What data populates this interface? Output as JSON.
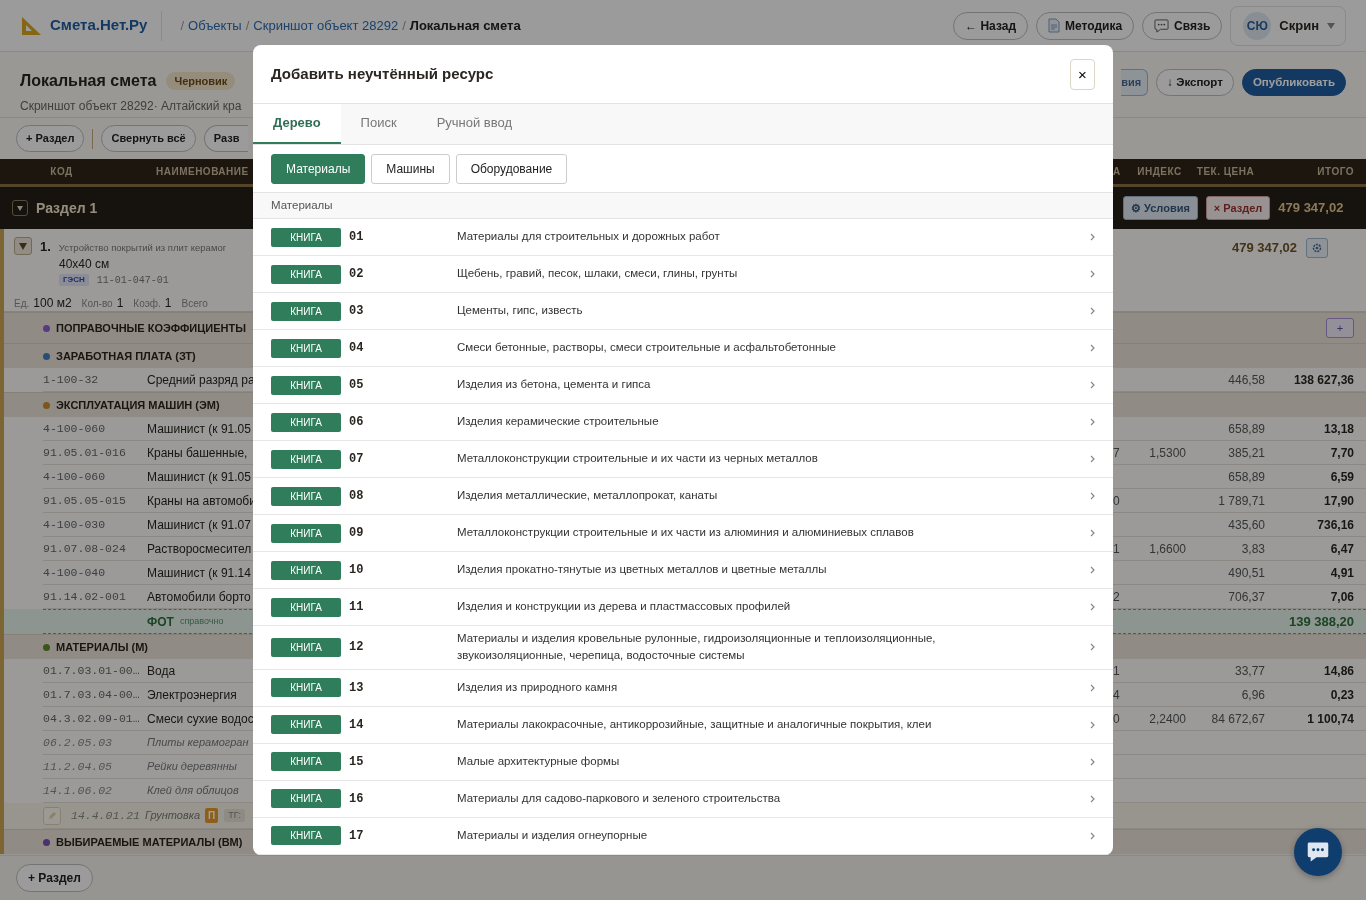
{
  "app": {
    "logo": "Смета.Нет.Ру",
    "breadcrumbs": [
      {
        "sep": "/",
        "label": "Объекты",
        "current": false
      },
      {
        "sep": "/",
        "label": "Скриншот объект 28292",
        "current": false
      },
      {
        "sep": "/",
        "label": "Локальная смета",
        "current": true
      }
    ],
    "header_buttons": [
      {
        "label": "← Назад"
      },
      {
        "label": "Методика"
      },
      {
        "label": "Связь"
      }
    ],
    "user": {
      "initials": "СЮ",
      "name": "Скрин"
    }
  },
  "page": {
    "title": "Локальная смета",
    "status": "Черновик",
    "subtitle": "Скриншот объект 28292· Алтайский кра",
    "actions": [
      {
        "label": "вия",
        "kind": "secondary"
      },
      {
        "label": "↓ Экспорт",
        "kind": "outline"
      },
      {
        "label": "Опубликовать",
        "kind": "primary"
      }
    ]
  },
  "toolbar": [
    "+ Раздел",
    "Свернуть всё",
    "Разв"
  ],
  "table": {
    "columns_left": [
      "КОД",
      "НАИМЕНОВАНИЕ"
    ],
    "columns_right": [
      "А",
      "ИНДЕКС",
      "ТЕК. ЦЕНА",
      "ИТОГО"
    ],
    "section": {
      "title": "Раздел 1",
      "buttons": [
        "⚙ Условия",
        "× Раздел"
      ],
      "total": "479 347,02"
    },
    "item": {
      "number": "1.",
      "title": "Устройство покрытий из плит керамог",
      "size": "40x40 см",
      "tag": "ГЭСН",
      "code": "11-01-047-01",
      "meta": [
        {
          "label": "Ед.",
          "value": "100 м2"
        },
        {
          "label": "Кол-во",
          "value": "1"
        },
        {
          "label": "Коэф.",
          "value": "1"
        },
        {
          "label": "Всего"
        }
      ],
      "total": "479 347,02"
    },
    "rows": [
      {
        "kind": "group",
        "label": "ПОПРАВОЧНЫЕ КОЭФФИЦИЕНТЫ",
        "color": "#563b83",
        "add": "+"
      },
      {
        "kind": "group",
        "label": "ЗАРАБОТНАЯ ПЛАТА (ЗТ)",
        "color": "#274f76"
      },
      {
        "kind": "line",
        "code": "1-100-32",
        "name": "Средний разряд ра",
        "price": "446,58",
        "total": "138 627,36"
      },
      {
        "kind": "group",
        "label": "ЭКСПЛУАТАЦИЯ МАШИН (ЭМ)",
        "color": "#7c561a"
      },
      {
        "kind": "line",
        "code": "4-100-060",
        "name": "Машинист (к 91.05",
        "price": "658,89",
        "total": "13,18"
      },
      {
        "kind": "line",
        "code": "91.05.01-016",
        "name": "Краны башенные,",
        "column_1": "7",
        "index": "1,5300",
        "price": "385,21",
        "total": "7,70"
      },
      {
        "kind": "line",
        "code": "4-100-060",
        "name": "Машинист (к 91.05",
        "price": "658,89",
        "total": "6,59"
      },
      {
        "kind": "line",
        "code": "91.05.05-015",
        "name": "Краны на автомоби",
        "column_1": "0",
        "price": "1 789,71",
        "total": "17,90"
      },
      {
        "kind": "line",
        "code": "4-100-030",
        "name": "Машинист (к 91.07",
        "price": "435,60",
        "total": "736,16"
      },
      {
        "kind": "line",
        "code": "91.07.08-024",
        "name": "Растворосмесител",
        "column_1": "1",
        "index": "1,6600",
        "price": "3,83",
        "total": "6,47"
      },
      {
        "kind": "line",
        "code": "4-100-040",
        "name": "Машинист (к 91.14",
        "price": "490,51",
        "total": "4,91"
      },
      {
        "kind": "line",
        "code": "91.14.02-001",
        "name": "Автомобили борто",
        "column_1": "2",
        "price": "706,37",
        "total": "7,06"
      },
      {
        "kind": "fot",
        "label": "ФОТ",
        "note": "справочно",
        "total": "139 388,20"
      },
      {
        "kind": "group",
        "label": "МАТЕРИАЛЫ (М)",
        "color": "#38561d"
      },
      {
        "kind": "line",
        "code": "01.7.03.01-00…",
        "name": "Вода",
        "column_1": "1",
        "price": "33,77",
        "total": "14,86"
      },
      {
        "kind": "line",
        "code": "01.7.03.04-00…",
        "name": "Электроэнергия",
        "column_1": "4",
        "price": "6,96",
        "total": "0,23"
      },
      {
        "kind": "line",
        "code": "04.3.02.09-01…",
        "name": "Смеси сухие водос",
        "column_1": "0",
        "index": "2,2400",
        "price": "84 672,67",
        "total": "1 100,74"
      },
      {
        "kind": "unaccounted",
        "code": "06.2.05.03",
        "name": "Плиты керамогран"
      },
      {
        "kind": "unaccounted",
        "code": "11.2.04.05",
        "name": "Рейки деревянны"
      },
      {
        "kind": "unaccounted",
        "code": "14.1.06.02",
        "name": "Клей для облицов"
      },
      {
        "kind": "edit",
        "code": "14.4.01.21",
        "name": "Грунтовка",
        "badge": "П",
        "tag": "ТГ:"
      },
      {
        "kind": "group",
        "label": "ВЫБИРАЕМЫЕ МАТЕРИАЛЫ (ВМ)",
        "color": "#4b316d"
      }
    ]
  },
  "footer_button": "+ Раздел",
  "modal": {
    "title": "Добавить неучтённый ресурс",
    "close": "×",
    "tabs": [
      {
        "label": "Дерево",
        "selected": true
      },
      {
        "label": "Поиск",
        "selected": false
      },
      {
        "label": "Ручной ввод",
        "selected": false
      }
    ],
    "filters": [
      {
        "label": "Материалы",
        "selected": true
      },
      {
        "label": "Машины",
        "selected": false
      },
      {
        "label": "Оборудование",
        "selected": false
      }
    ],
    "list_heading": "Материалы",
    "items": [
      {
        "tag": "КНИГА",
        "code": "01",
        "name": "Материалы для строительных и дорожных работ"
      },
      {
        "tag": "КНИГА",
        "code": "02",
        "name": "Щебень, гравий, песок, шлаки, смеси, глины, грунты"
      },
      {
        "tag": "КНИГА",
        "code": "03",
        "name": "Цементы, гипс, известь"
      },
      {
        "tag": "КНИГА",
        "code": "04",
        "name": "Смеси бетонные, растворы, смеси строительные и асфальтобетонные"
      },
      {
        "tag": "КНИГА",
        "code": "05",
        "name": "Изделия из бетона, цемента и гипса"
      },
      {
        "tag": "КНИГА",
        "code": "06",
        "name": "Изделия керамические строительные"
      },
      {
        "tag": "КНИГА",
        "code": "07",
        "name": "Металлоконструкции строительные и их части из черных металлов"
      },
      {
        "tag": "КНИГА",
        "code": "08",
        "name": "Изделия металлические, металлопрокат, канаты"
      },
      {
        "tag": "КНИГА",
        "code": "09",
        "name": "Металлоконструкции строительные и их части из алюминия и алюминиевых сплавов"
      },
      {
        "tag": "КНИГА",
        "code": "10",
        "name": "Изделия прокатно-тянутые из цветных металлов и цветные металлы"
      },
      {
        "tag": "КНИГА",
        "code": "11",
        "name": "Изделия и конструкции из дерева и пластмассовых профилей"
      },
      {
        "tag": "КНИГА",
        "code": "12",
        "name": "Материалы и изделия кровельные рулонные, гидроизоляционные и теплоизоляционные, звукоизоляционные, черепица, водосточные системы"
      },
      {
        "tag": "КНИГА",
        "code": "13",
        "name": "Изделия из природного камня"
      },
      {
        "tag": "КНИГА",
        "code": "14",
        "name": "Материалы лакокрасочные, антикоррозийные, защитные и аналогичные покрытия, клеи"
      },
      {
        "tag": "КНИГА",
        "code": "15",
        "name": "Малые архитектурные формы"
      },
      {
        "tag": "КНИГА",
        "code": "16",
        "name": "Материалы для садово-паркового и зеленого строительства"
      },
      {
        "tag": "КНИГА",
        "code": "17",
        "name": "Материалы и изделия огнеупорные"
      }
    ]
  }
}
